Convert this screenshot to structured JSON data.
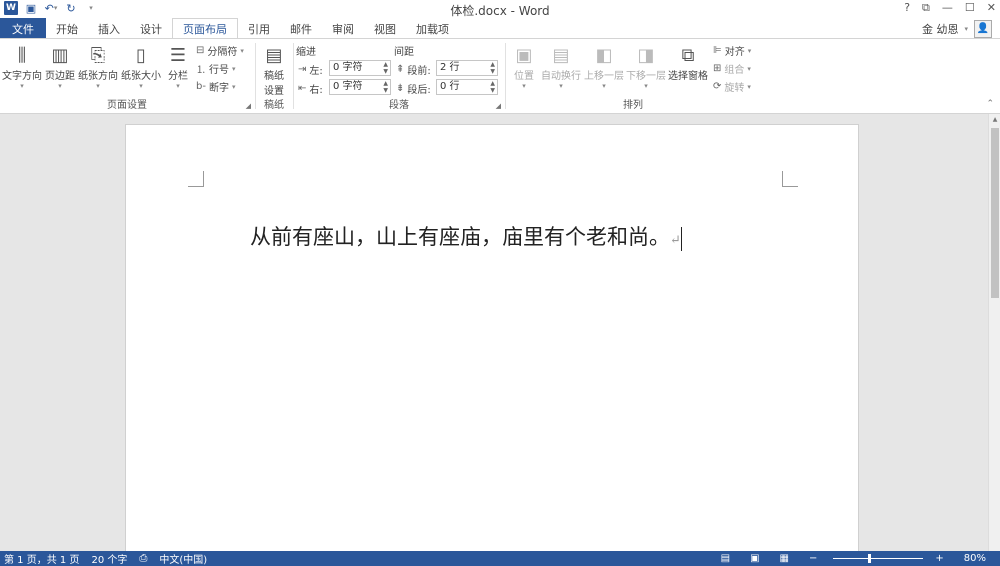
{
  "window": {
    "title": "体检.docx - Word",
    "controls": [
      "?",
      "⧉",
      "—",
      "☐",
      "✕"
    ]
  },
  "qat": {
    "icons": [
      "word-logo",
      "save-icon",
      "undo-icon",
      "redo-icon",
      "customize-icon"
    ]
  },
  "tabs": [
    "文件",
    "开始",
    "插入",
    "设计",
    "页面布局",
    "引用",
    "邮件",
    "审阅",
    "视图",
    "加载项"
  ],
  "active_tab": "页面布局",
  "user": {
    "name": "金 幼恩"
  },
  "ribbon": {
    "page_setup": {
      "label": "页面设置",
      "text_direction": "文字方向",
      "margins": "页边距",
      "orientation": "纸张方向",
      "size": "纸张大小",
      "columns": "分栏",
      "breaks": "分隔符",
      "line_numbers": "行号",
      "hyphenation": "断字"
    },
    "manuscript": {
      "label": "稿纸",
      "button_line1": "稿纸",
      "button_line2": "设置"
    },
    "paragraph": {
      "label": "段落",
      "indent_heading": "缩进",
      "spacing_heading": "间距",
      "left_label": "左:",
      "left_value": "0 字符",
      "right_label": "右:",
      "right_value": "0 字符",
      "before_label": "段前:",
      "before_value": "2 行",
      "after_label": "段后:",
      "after_value": "0 行"
    },
    "arrange": {
      "label": "排列",
      "position": "位置",
      "wrap_text": "自动换行",
      "bring_forward": "上移一层",
      "send_backward": "下移一层",
      "selection_pane": "选择窗格",
      "align": "对齐",
      "group": "组合",
      "rotate": "旋转"
    }
  },
  "document": {
    "text": "从前有座山，山上有座庙，庙里有个老和尚。",
    "paragraph_mark": "↵"
  },
  "status": {
    "page": "第 1 页，共 1 页",
    "words": "20 个字",
    "language": "中文(中国)",
    "zoom": "80%",
    "zoom_value": 0.8
  }
}
